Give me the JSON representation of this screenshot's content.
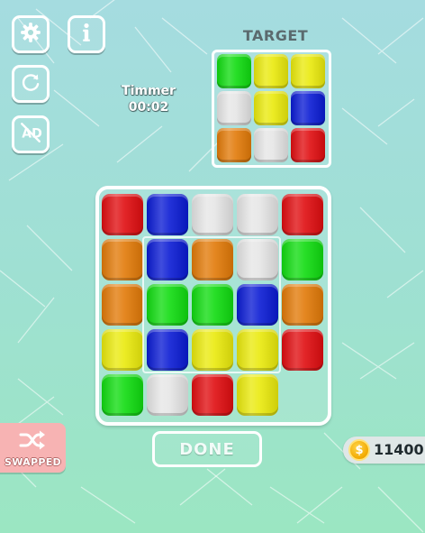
{
  "colors": {
    "red": "#e00d10",
    "blue": "#0a1bd4",
    "white": "#e6e6e6",
    "orange": "#e27a08",
    "green": "#10dc10",
    "yellow": "#eaea0c"
  },
  "toolbar": {
    "settings_icon": "gear-icon",
    "info_icon": "info-icon",
    "restart_icon": "restart-icon",
    "no_ads_icon": "no-ads-icon",
    "no_ads_label": "AD"
  },
  "timer": {
    "label": "Timmer",
    "value": "00:02"
  },
  "target": {
    "title": "TARGET",
    "grid": [
      [
        "green",
        "yellow",
        "yellow"
      ],
      [
        "white",
        "yellow",
        "blue"
      ],
      [
        "orange",
        "white",
        "red"
      ]
    ]
  },
  "board": {
    "grid": [
      [
        "red",
        "blue",
        "white",
        "white",
        "red"
      ],
      [
        "orange",
        "blue",
        "orange",
        "white",
        "green"
      ],
      [
        "orange",
        "green",
        "green",
        "blue",
        "orange"
      ],
      [
        "yellow",
        "blue",
        "yellow",
        "yellow",
        "red"
      ],
      [
        "green",
        "white",
        "red",
        "yellow",
        null
      ]
    ]
  },
  "done_label": "DONE",
  "swap": {
    "icon": "shuffle-icon",
    "label": "SWAPPED"
  },
  "coins": {
    "icon": "coin-icon",
    "symbol": "$",
    "value": "11400"
  }
}
